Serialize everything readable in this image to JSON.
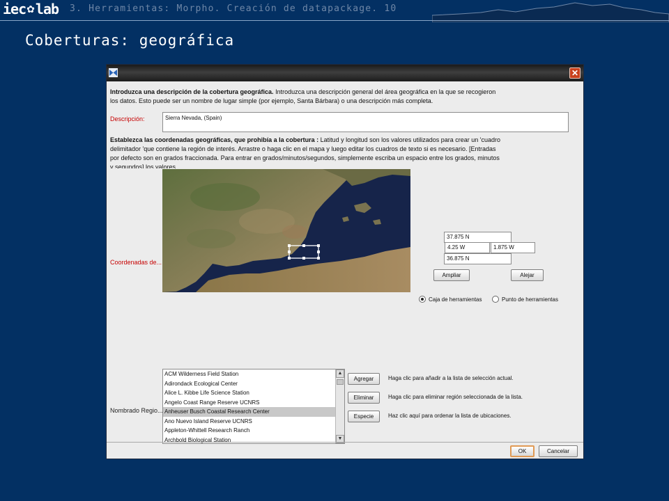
{
  "slide": {
    "logo": {
      "part1": "iec",
      "part2": "lab"
    },
    "breadcrumb": "3. Herramientas: Morpho. Creación de datapackage. 10",
    "title": "Coberturas: geográfica"
  },
  "dialog": {
    "intro_bold": "Introduzca una descripción de la cobertura geográfica.",
    "intro_text": " Introduzca una descripción general del área geográfica en la que se recogieron los datos. Esto puede ser un nombre de lugar simple (por ejemplo, Santa Bárbara) o una descripción más completa.",
    "description_label": "Descripción:",
    "description_value": "Sierra Nevada, (Spain)",
    "coords_bold": "Establezca las coordenadas geográficas, que prohibía a la cobertura :",
    "coords_text": " Latitud y longitud son los valores utilizados para crear un 'cuadro delimitador 'que contiene la región de interés. Arrastre o haga clic en el mapa y luego editar los cuadros de texto si es necesario. [Entradas por defecto son en grados fraccionada. Para entrar en grados/minutos/segundos, simplemente escriba un espacio entre los grados, minutos y segundos] los valores.",
    "coords_label": "Coordenadas de...",
    "north": "37.875 N",
    "south": "36.875 N",
    "west": "4.25 W",
    "east": "1.875 W",
    "zoom_in": "Ampliar",
    "zoom_out": "Alejar",
    "radio_toolbox": "Caja de herramientas",
    "radio_point": "Punto de herramientas",
    "radio_selected": "Caja de herramientas",
    "named_regions_label": "Nombrado Regio...",
    "regions": [
      "ACM Wilderness Field Station",
      "Adirondack Ecological Center",
      "Alice L. Kibbe Life Science Station",
      "Angelo Coast Range Reserve UCNRS",
      "Anheuser Busch Coastal Research Center",
      "Ano Nuevo Island Reserve UCNRS",
      "Appleton-Whittell Research Ranch",
      "Archbold Biological Station"
    ],
    "selected_region": "Anheuser Busch Coastal Research Center",
    "add_button": "Agregar",
    "remove_button": "Eliminar",
    "species_button": "Especie",
    "add_help": "Haga clic para añadir a la lista de selección actual.",
    "remove_help": "Haga clic para eliminar región seleccionada de la lista.",
    "species_help": "Haz clic aquí para ordenar la lista de ubicaciones.",
    "ok_button": "OK",
    "cancel_button": "Cancelar"
  }
}
